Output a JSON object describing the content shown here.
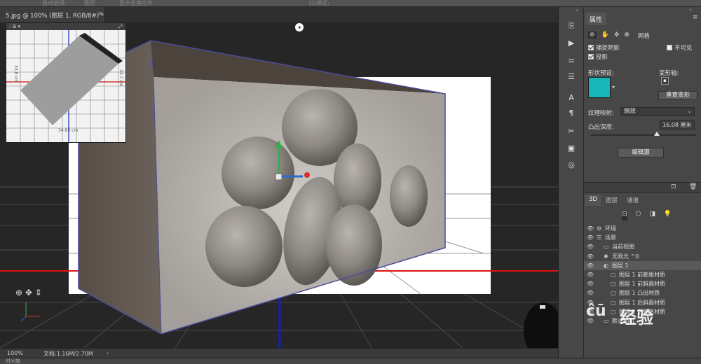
{
  "menubar": {
    "item1": "自动选择:",
    "item2": "图层",
    "item3": "显示变换控件",
    "item4": "3D模式:"
  },
  "document_tab": {
    "title": "5.jpg @ 100% (图层 1, RGB/8#) *",
    "close": "×"
  },
  "navigator": {
    "dim_vertical_left": "33.8 cm",
    "dim_vertical_right": "33.7 cm",
    "dim_horizontal": "34.65 cm"
  },
  "status": {
    "zoom": "100%",
    "doc_size": "文档:1.16M/2.70M"
  },
  "timeline": {
    "label": "时间轴"
  },
  "properties": {
    "tab": "属性",
    "mode_label": "网格",
    "catch_shadows": "捕捉阴影",
    "cast_shadows": "投影",
    "invisible": "不可见",
    "shape_preset_label": "形状预设:",
    "deform_axis_label": "变形轴:",
    "reset_deform": "重置变形",
    "texture_map_label": "纹理映射:",
    "texture_map_value": "缩放",
    "extrude_depth_label": "凸出深度:",
    "extrude_depth_value": "16.08 厘米",
    "edit_source": "编辑源",
    "preset_color": "#19b6b8"
  },
  "layers_panel": {
    "tabs": [
      "3D",
      "图层",
      "通道"
    ],
    "rows": [
      {
        "name": "环境",
        "indent": 0
      },
      {
        "name": "场景",
        "indent": 0
      },
      {
        "name": "当前视图",
        "indent": 1
      },
      {
        "name": "无限光 ^0",
        "indent": 1
      },
      {
        "name": "图层 1",
        "indent": 1
      },
      {
        "name": "图层 1 前膨胀材质",
        "indent": 2
      },
      {
        "name": "图层 1 前斜面材质",
        "indent": 2
      },
      {
        "name": "图层 1 凸出材质",
        "indent": 2
      },
      {
        "name": "图层 1 后斜面材质",
        "indent": 2
      },
      {
        "name": "图层 1 后膨胀材质",
        "indent": 2
      },
      {
        "name": "默认相机",
        "indent": 1
      }
    ]
  },
  "watermark": {
    "text": "经验",
    "brand": "Bai du"
  },
  "colors": {
    "red_axis": "#e01010",
    "blue_axis": "#1020c0",
    "box_edge": "#4b4c9a"
  }
}
